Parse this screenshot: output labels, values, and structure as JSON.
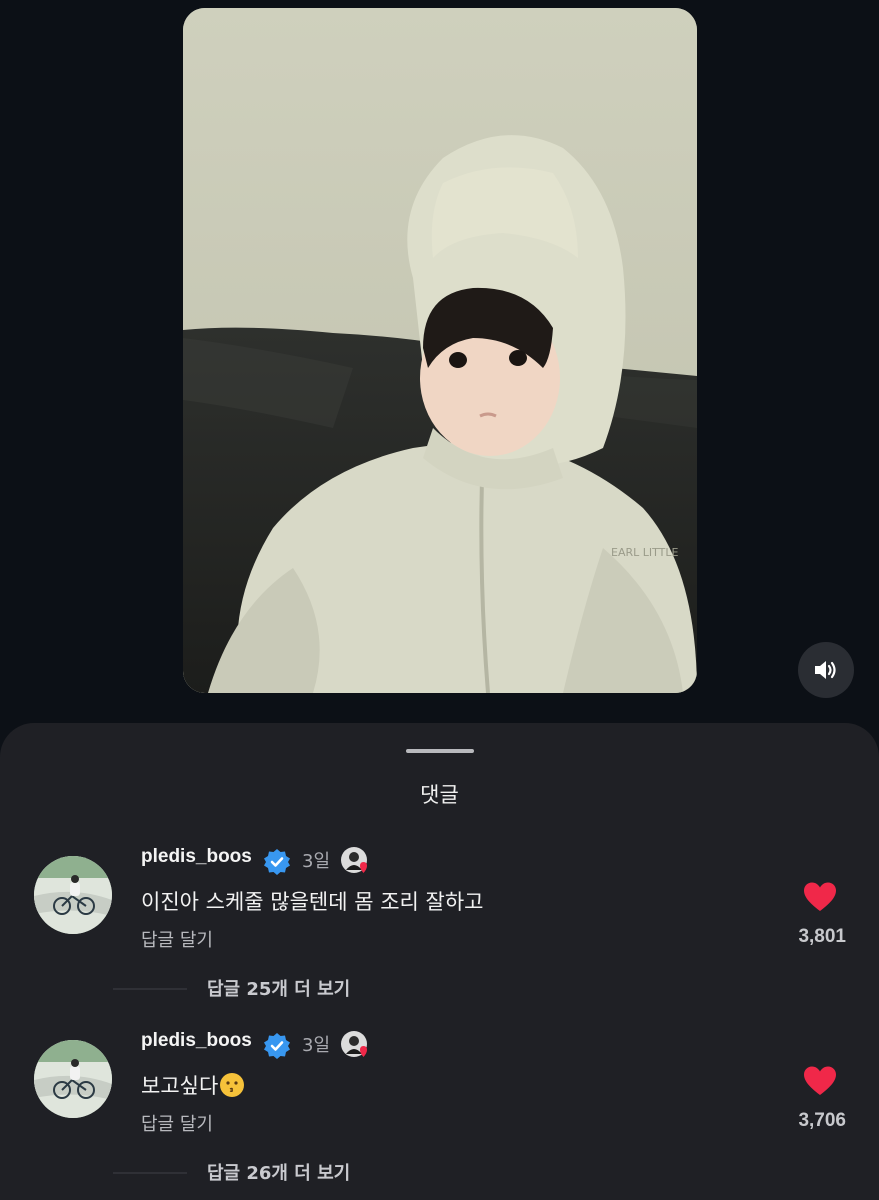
{
  "media": {
    "photo_caption_on_jacket": "EARL LITTLE"
  },
  "sheet": {
    "title": "댓글"
  },
  "comments": [
    {
      "username": "pledis_boos",
      "time": "3일",
      "text": "이진아 스케줄 많을텐데 몸 조리 잘하고",
      "reply_label": "답글 달기",
      "likes": "3,801",
      "more_replies": "답글 25개 더 보기"
    },
    {
      "username": "pledis_boos",
      "time": "3일",
      "text": "보고싶다",
      "text_emoji": "kissing-face-emoji",
      "reply_label": "답글 달기",
      "likes": "3,706",
      "more_replies": "답글 26개 더 보기"
    }
  ],
  "colors": {
    "background": "#0d1117",
    "sheet": "#1f2025",
    "like_red": "#f02849",
    "verified_blue": "#3897f0"
  }
}
